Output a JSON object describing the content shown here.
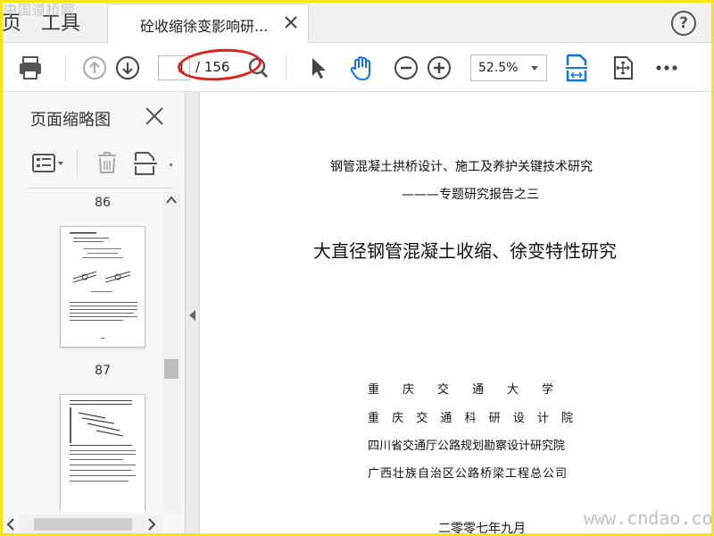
{
  "tabs": {
    "home_label": "页",
    "tools_label": "工具",
    "document_title": "砼收缩徐变影响研..."
  },
  "watermarks": {
    "top_left": "中国道桥网",
    "bottom_right": "www.cndao.com"
  },
  "toolbar": {
    "current_page": "1",
    "total_pages": "/ 156",
    "zoom": "52.5%"
  },
  "left_panel": {
    "title": "页面缩略图",
    "thumbnails": [
      {
        "page_label": "86"
      },
      {
        "page_label": "87"
      }
    ]
  },
  "document": {
    "header_title": "钢管混凝土拱桥设计、施工及养护关键技术研究",
    "series_line": "———专题研究报告之三",
    "main_title": "大直径钢管混凝土收缩、徐变特性研究",
    "institutions": [
      "重　　庆　　交　　通　　大　　学",
      "重 庆 交 通 科 研 设 计 院",
      "四川省交通厅公路规划勘察设计研究院",
      "广西壮族自治区公路桥梁工程总公司"
    ],
    "date": "二零零七年九月"
  },
  "colors": {
    "accent_blue": "#1473e6",
    "annotation_red": "#e0201c",
    "frame_yellow": "#f5e31b"
  }
}
